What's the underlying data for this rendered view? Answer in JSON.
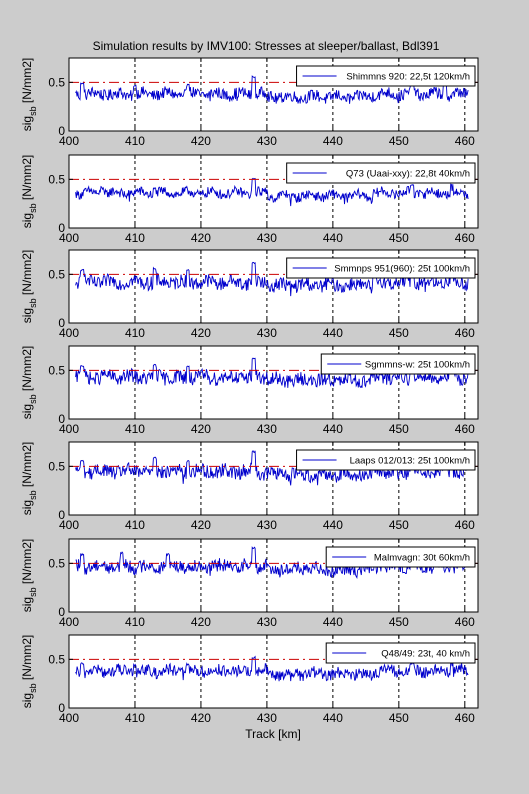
{
  "title": "Simulation results by IMV100: Stresses at sleeper/ballast, Bdl391",
  "xlabel": "Track [km]",
  "ylabel_main": "sig",
  "ylabel_sub": "sb",
  "ylabel_unit": " [N/mm2]",
  "colors": {
    "figure_bg": "#cccccc",
    "axes_bg": "#ffffff",
    "series": "#0000cc",
    "limit": "#cc0000",
    "grid": "#000000"
  },
  "chart_data": [
    {
      "type": "line",
      "xlim": [
        400,
        462
      ],
      "ylim": [
        0,
        0.75
      ],
      "xticks": [
        400,
        410,
        420,
        430,
        440,
        450,
        460
      ],
      "yticks": [
        0,
        0.5
      ],
      "grid": "vertical dashed at x ticks",
      "limit_line": 0.5,
      "legend": "Shimmns 920: 22,5t 120km/h",
      "legend_position": "top-right",
      "baseline": 0.38,
      "amplitude": 0.06,
      "peaks": [
        [
          402,
          0.5
        ],
        [
          410,
          0.47
        ],
        [
          418,
          0.48
        ],
        [
          428,
          0.57
        ],
        [
          452,
          0.49
        ],
        [
          457,
          0.5
        ]
      ]
    },
    {
      "type": "line",
      "xlim": [
        400,
        462
      ],
      "ylim": [
        0,
        0.75
      ],
      "xticks": [
        400,
        410,
        420,
        430,
        440,
        450,
        460
      ],
      "yticks": [
        0,
        0.5
      ],
      "grid": "vertical dashed at x ticks",
      "limit_line": 0.5,
      "legend": "Q73 (Uaai-xxy): 22,8t 40km/h",
      "legend_position": "top-right",
      "baseline": 0.36,
      "amplitude": 0.05,
      "peaks": [
        [
          405,
          0.43
        ],
        [
          413,
          0.42
        ],
        [
          428,
          0.52
        ],
        [
          452,
          0.45
        ],
        [
          458,
          0.46
        ]
      ]
    },
    {
      "type": "line",
      "xlim": [
        400,
        462
      ],
      "ylim": [
        0,
        0.75
      ],
      "xticks": [
        400,
        410,
        420,
        430,
        440,
        450,
        460
      ],
      "yticks": [
        0,
        0.5
      ],
      "grid": "vertical dashed at x ticks",
      "limit_line": 0.5,
      "legend": "Smmnps 951(960): 25t 100km/h",
      "legend_position": "top-right",
      "baseline": 0.42,
      "amplitude": 0.07,
      "peaks": [
        [
          402,
          0.55
        ],
        [
          413,
          0.57
        ],
        [
          418,
          0.55
        ],
        [
          428,
          0.63
        ],
        [
          452,
          0.56
        ],
        [
          458,
          0.56
        ]
      ]
    },
    {
      "type": "line",
      "xlim": [
        400,
        462
      ],
      "ylim": [
        0,
        0.75
      ],
      "xticks": [
        400,
        410,
        420,
        430,
        440,
        450,
        460
      ],
      "yticks": [
        0,
        0.5
      ],
      "grid": "vertical dashed at x ticks",
      "limit_line": 0.5,
      "legend": "Sgmmns-w: 25t 100km/h",
      "legend_position": "top-right",
      "baseline": 0.43,
      "amplitude": 0.07,
      "peaks": [
        [
          402,
          0.55
        ],
        [
          413,
          0.57
        ],
        [
          418,
          0.55
        ],
        [
          428,
          0.63
        ],
        [
          452,
          0.56
        ],
        [
          458,
          0.56
        ]
      ]
    },
    {
      "type": "line",
      "xlim": [
        400,
        462
      ],
      "ylim": [
        0,
        0.75
      ],
      "xticks": [
        400,
        410,
        420,
        430,
        440,
        450,
        460
      ],
      "yticks": [
        0,
        0.5
      ],
      "grid": "vertical dashed at x ticks",
      "limit_line": 0.5,
      "legend": "Laaps 012/013: 25t 100km/h",
      "legend_position": "top-right",
      "baseline": 0.45,
      "amplitude": 0.07,
      "peaks": [
        [
          402,
          0.57
        ],
        [
          413,
          0.6
        ],
        [
          418,
          0.56
        ],
        [
          428,
          0.66
        ],
        [
          452,
          0.57
        ],
        [
          458,
          0.58
        ]
      ]
    },
    {
      "type": "line",
      "xlim": [
        400,
        462
      ],
      "ylim": [
        0,
        0.75
      ],
      "xticks": [
        400,
        410,
        420,
        430,
        440,
        450,
        460
      ],
      "yticks": [
        0,
        0.5
      ],
      "grid": "vertical dashed at x ticks",
      "limit_line": 0.5,
      "legend": "Malmvagn: 30t 60km/h",
      "legend_position": "top-right",
      "baseline": 0.47,
      "amplitude": 0.07,
      "peaks": [
        [
          402,
          0.6
        ],
        [
          408,
          0.62
        ],
        [
          415,
          0.6
        ],
        [
          428,
          0.67
        ],
        [
          452,
          0.58
        ],
        [
          458,
          0.6
        ]
      ]
    },
    {
      "type": "line",
      "xlim": [
        400,
        462
      ],
      "ylim": [
        0,
        0.75
      ],
      "xticks": [
        400,
        410,
        420,
        430,
        440,
        450,
        460
      ],
      "yticks": [
        0,
        0.5
      ],
      "grid": "vertical dashed at x ticks",
      "limit_line": 0.5,
      "legend": "Q48/49: 23t, 40 km/h",
      "legend_position": "top-right",
      "baseline": 0.38,
      "amplitude": 0.06,
      "peaks": [
        [
          402,
          0.47
        ],
        [
          410,
          0.45
        ],
        [
          418,
          0.46
        ],
        [
          428,
          0.53
        ],
        [
          452,
          0.47
        ],
        [
          458,
          0.48
        ]
      ]
    }
  ]
}
